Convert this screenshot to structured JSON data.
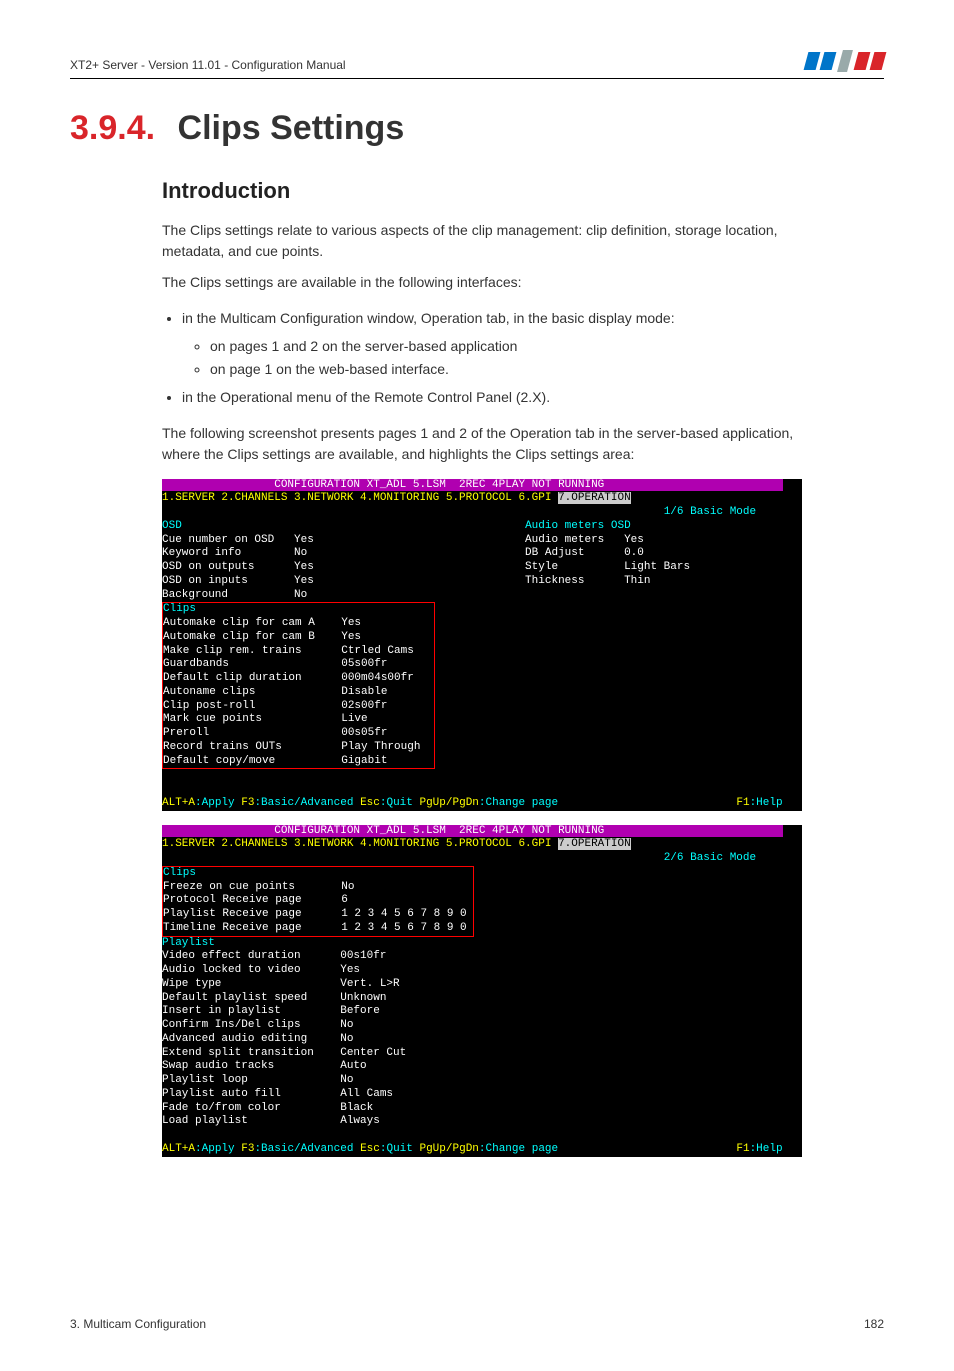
{
  "header": {
    "left": "XT2+ Server - Version 11.01 - Configuration Manual"
  },
  "section": {
    "number": "3.9.4.",
    "title": "Clips Settings"
  },
  "intro": {
    "heading": "Introduction",
    "p1": "The Clips settings relate to various aspects of the clip management: clip definition, storage location, metadata, and cue points.",
    "p2": "The Clips settings are available in the following interfaces:",
    "b1": "in the Multicam Configuration window, Operation tab, in the basic display mode:",
    "b1a": "on pages 1 and 2 on the server-based application",
    "b1b": "on page 1 on the web-based interface.",
    "b2": "in the Operational menu of the Remote Control Panel (2.X).",
    "p3": "The following screenshot presents pages 1 and 2 of the Operation tab in the server-based application, where the Clips settings are available, and highlights the Clips settings area:"
  },
  "terminal1": {
    "title": "CONFIGURATION XT_ADL 5.LSM  2REC 4PLAY NOT RUNNING",
    "menu": "1.SERVER 2.CHANNELS 3.NETWORK 4.MONITORING 5.PROTOCOL 6.GPI ",
    "menuActive": "7.OPERATION",
    "mode": "1/6 Basic Mode",
    "osd": {
      "header": "OSD",
      "rows": [
        [
          "Cue number on OSD",
          "Yes"
        ],
        [
          "Keyword info",
          "No"
        ],
        [
          "OSD on outputs",
          "Yes"
        ],
        [
          "OSD on inputs",
          "Yes"
        ],
        [
          "Background",
          "No"
        ]
      ]
    },
    "audio": {
      "header": "Audio meters OSD",
      "rows": [
        [
          "Audio meters",
          "Yes"
        ],
        [
          "DB Adjust",
          "0.0"
        ],
        [
          "Style",
          "Light Bars"
        ],
        [
          "Thickness",
          "Thin"
        ]
      ]
    },
    "clips": {
      "header": "Clips",
      "rows": [
        [
          "Automake clip for cam A",
          "Yes"
        ],
        [
          "Automake clip for cam B",
          "Yes"
        ],
        [
          "Make clip rem. trains",
          "Ctrled Cams"
        ],
        [
          "Guardbands",
          "05s00fr"
        ],
        [
          "Default clip duration",
          "000m04s00fr"
        ],
        [
          "Autoname clips",
          "Disable"
        ],
        [
          "Clip post-roll",
          "02s00fr"
        ],
        [
          "Mark cue points",
          "Live"
        ],
        [
          "Preroll",
          "00s05fr"
        ],
        [
          "Record trains OUTs",
          "Play Through"
        ],
        [
          "Default copy/move",
          "Gigabit"
        ]
      ]
    },
    "footer": {
      "k1": "ALT+A",
      "v1": ":Apply ",
      "k2": "F3",
      "v2": ":Basic/Advanced ",
      "k3": "Esc",
      "v3": ":Quit ",
      "k4": "PgUp/PgDn",
      "v4": ":Change page",
      "k5": "F1",
      "v5": ":Help"
    }
  },
  "terminal2": {
    "title": "CONFIGURATION XT_ADL 5.LSM  2REC 4PLAY NOT RUNNING",
    "menu": "1.SERVER 2.CHANNELS 3.NETWORK 4.MONITORING 5.PROTOCOL 6.GPI ",
    "menuActive": "7.OPERATION",
    "mode": "2/6 Basic Mode",
    "clips": {
      "header": "Clips",
      "rows": [
        [
          "Freeze on cue points",
          "No"
        ],
        [
          "Protocol Receive page",
          "6"
        ],
        [
          "Playlist Receive page",
          "1 2 3 4 5 6 7 8 9 0"
        ],
        [
          "Timeline Receive page",
          "1 2 3 4 5 6 7 8 9 0"
        ]
      ]
    },
    "playlist": {
      "header": "Playlist",
      "rows": [
        [
          "Video effect duration",
          "00s10fr"
        ],
        [
          "Audio locked to video",
          "Yes"
        ],
        [
          "Wipe type",
          "Vert. L>R"
        ],
        [
          "Default playlist speed",
          "Unknown"
        ],
        [
          "Insert in playlist",
          "Before"
        ],
        [
          "Confirm Ins/Del clips",
          "No"
        ],
        [
          "Advanced audio editing",
          "No"
        ],
        [
          "Extend split transition",
          "Center Cut"
        ],
        [
          "Swap audio tracks",
          "Auto"
        ],
        [
          "Playlist loop",
          "No"
        ],
        [
          "Playlist auto fill",
          "All Cams"
        ],
        [
          "Fade to/from color",
          "Black"
        ],
        [
          "Load playlist",
          "Always"
        ]
      ]
    },
    "footer": {
      "k1": "ALT+A",
      "v1": ":Apply ",
      "k2": "F3",
      "v2": ":Basic/Advanced ",
      "k3": "Esc",
      "v3": ":Quit ",
      "k4": "PgUp/PgDn",
      "v4": ":Change page",
      "k5": "F1",
      "v5": ":Help"
    }
  },
  "pageFooter": {
    "left": "3. Multicam Configuration",
    "right": "182"
  }
}
